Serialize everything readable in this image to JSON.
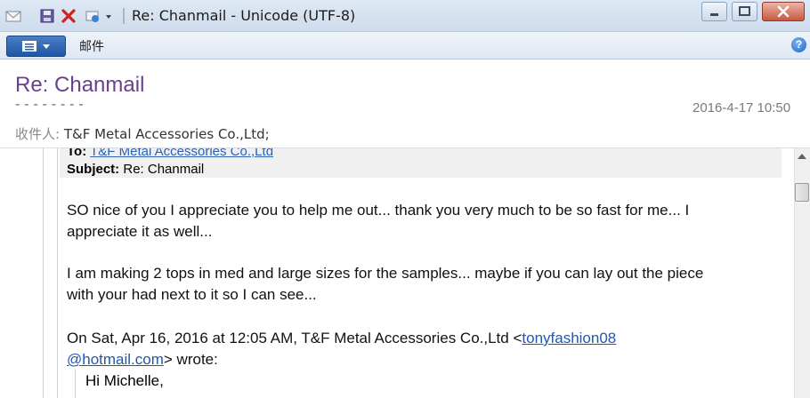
{
  "window": {
    "title": "Re: Chanmail - Unicode (UTF-8)"
  },
  "ribbon": {
    "mail_tab": "邮件",
    "help_label": "?"
  },
  "message": {
    "subject": "Re: Chanmail",
    "sender_fragment": "- - - - - - - -",
    "date": "2016-4-17 10:50",
    "recipients_label": "收件人:",
    "recipients": "T&F Metal Accessories Co.,Ltd;"
  },
  "quoted_header": {
    "to_label": "To:",
    "to_value": "T&F Metal Accessories Co.,Ltd",
    "subject_label": "Subject:",
    "subject_value": "Re: Chanmail"
  },
  "body": {
    "para1_line1": "SO nice of you I appreciate you to help me out... thank you very much to be so fast for me... I",
    "para1_line2": "appreciate it as well...",
    "para2_line1": "I am making 2 tops in med and large sizes for the samples... maybe if you can lay out the piece",
    "para2_line2": "with your had next to it so I can see...",
    "quote_intro_prefix": "On Sat, Apr 16, 2016 at 12:05 AM, T&F Metal Accessories Co.,Ltd <",
    "quote_email_part1": "tonyfashion08",
    "quote_email_part2": "@hotmail.com",
    "quote_intro_suffix": "> wrote:",
    "greeting": "Hi Michelle,"
  }
}
